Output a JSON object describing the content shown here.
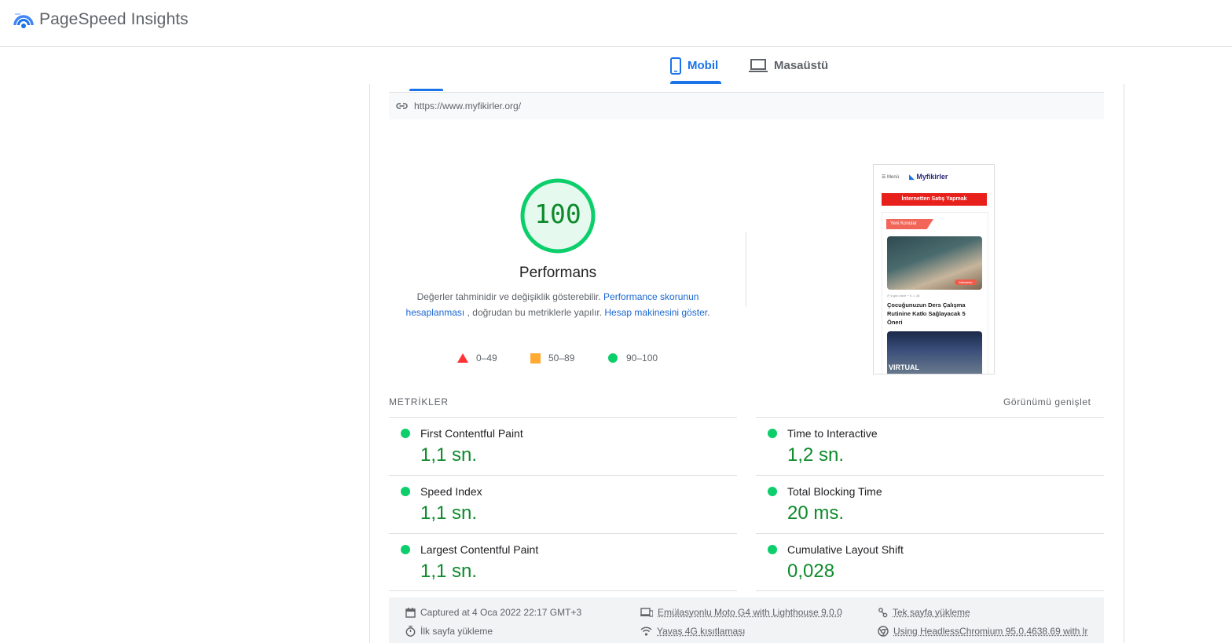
{
  "header": {
    "app_title": "PageSpeed Insights"
  },
  "tabs": [
    {
      "label": "Mobil",
      "icon": "smartphone-icon",
      "active": true
    },
    {
      "label": "Masaüstü",
      "icon": "laptop-icon",
      "active": false
    }
  ],
  "url_bar": {
    "url": "https://www.myfikirler.org/",
    "icon": "link-icon"
  },
  "performance": {
    "score": "100",
    "score_fraction": 1.0,
    "title": "Performans",
    "desc_prefix": "Değerler tahminidir ve değişiklik gösterebilir.",
    "link1": "Performance skorunun hesaplanması",
    "desc_middle": ", doğrudan bu metriklerle yapılır.",
    "link2": "Hesap makinesini göster",
    "desc_suffix": "."
  },
  "legend": [
    {
      "label": "0–49",
      "shape": "triangle",
      "color": "#ff3333"
    },
    {
      "label": "50–89",
      "shape": "square",
      "color": "#ffaa33"
    },
    {
      "label": "90–100",
      "shape": "circle",
      "color": "#0cce6b"
    }
  ],
  "screenshot": {
    "menu": "☰ Menü",
    "brand": "Myfikirler",
    "banner": "İnternetten Satış Yapmak",
    "tag": "Yeni Konular",
    "badge": "Makaleler",
    "meta": "◷ 6 gün önce  ◔ 0  ♨ 26",
    "post_title": "Çocuğunuzun Ders Çalışma Rutinine Katkı Sağlayacak 5 Öneri",
    "photo2_text": "VIRTUAL"
  },
  "metrics": {
    "section_label": "METRİKLER",
    "expand_label": "Görünümü genişlet",
    "items": [
      {
        "name": "First Contentful Paint",
        "value": "1,1 sn."
      },
      {
        "name": "Time to Interactive",
        "value": "1,2 sn."
      },
      {
        "name": "Speed Index",
        "value": "1,1 sn."
      },
      {
        "name": "Total Blocking Time",
        "value": "20 ms."
      },
      {
        "name": "Largest Contentful Paint",
        "value": "1,1 sn."
      },
      {
        "name": "Cumulative Layout Shift",
        "value": "0,028"
      }
    ]
  },
  "runtime": {
    "captured": "Captured at 4 Oca 2022 22:17 GMT+3",
    "device": "Emülasyonlu Moto G4 with Lighthouse 9.0.0",
    "single_page": "Tek sayfa yükleme",
    "initial_load": "İlk sayfa yükleme",
    "throttling": "Yavaş 4G kısıtlaması",
    "browser": "Using HeadlessChromium 95.0.4638.69 with lr"
  },
  "colors": {
    "accent": "#1a73e8",
    "pass": "#0cce6b",
    "pass_text": "#0d8a2b"
  }
}
